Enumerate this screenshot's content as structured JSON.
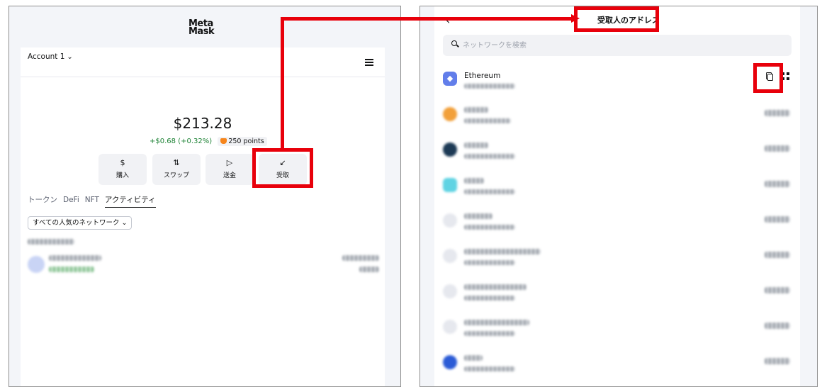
{
  "left": {
    "logo_line1": "Meta",
    "logo_line2": "Mask",
    "account_name": "Account 1",
    "balance": "$213.28",
    "change": "+$0.68 (+0.32%)",
    "points": "250 points",
    "actions": [
      {
        "label": "購入",
        "icon": "dollar-icon"
      },
      {
        "label": "スワップ",
        "icon": "swap-icon"
      },
      {
        "label": "送金",
        "icon": "send-icon"
      },
      {
        "label": "受取",
        "icon": "receive-icon"
      }
    ],
    "tabs": [
      "トークン",
      "DeFi",
      "NFT",
      "アクティビティ"
    ],
    "active_tab": "アクティビティ",
    "network_filter": "すべての人気のネットワーク"
  },
  "right": {
    "title": "受取人のアドレス",
    "search_placeholder": "ネットワークを検索",
    "networks": [
      {
        "name": "Ethereum",
        "icon": "ethereum-icon"
      }
    ]
  },
  "colors": {
    "highlight": "#e8000b",
    "positive": "#1c8234",
    "ethereum": "#627eea",
    "metamask_fox": "#f6851b"
  }
}
